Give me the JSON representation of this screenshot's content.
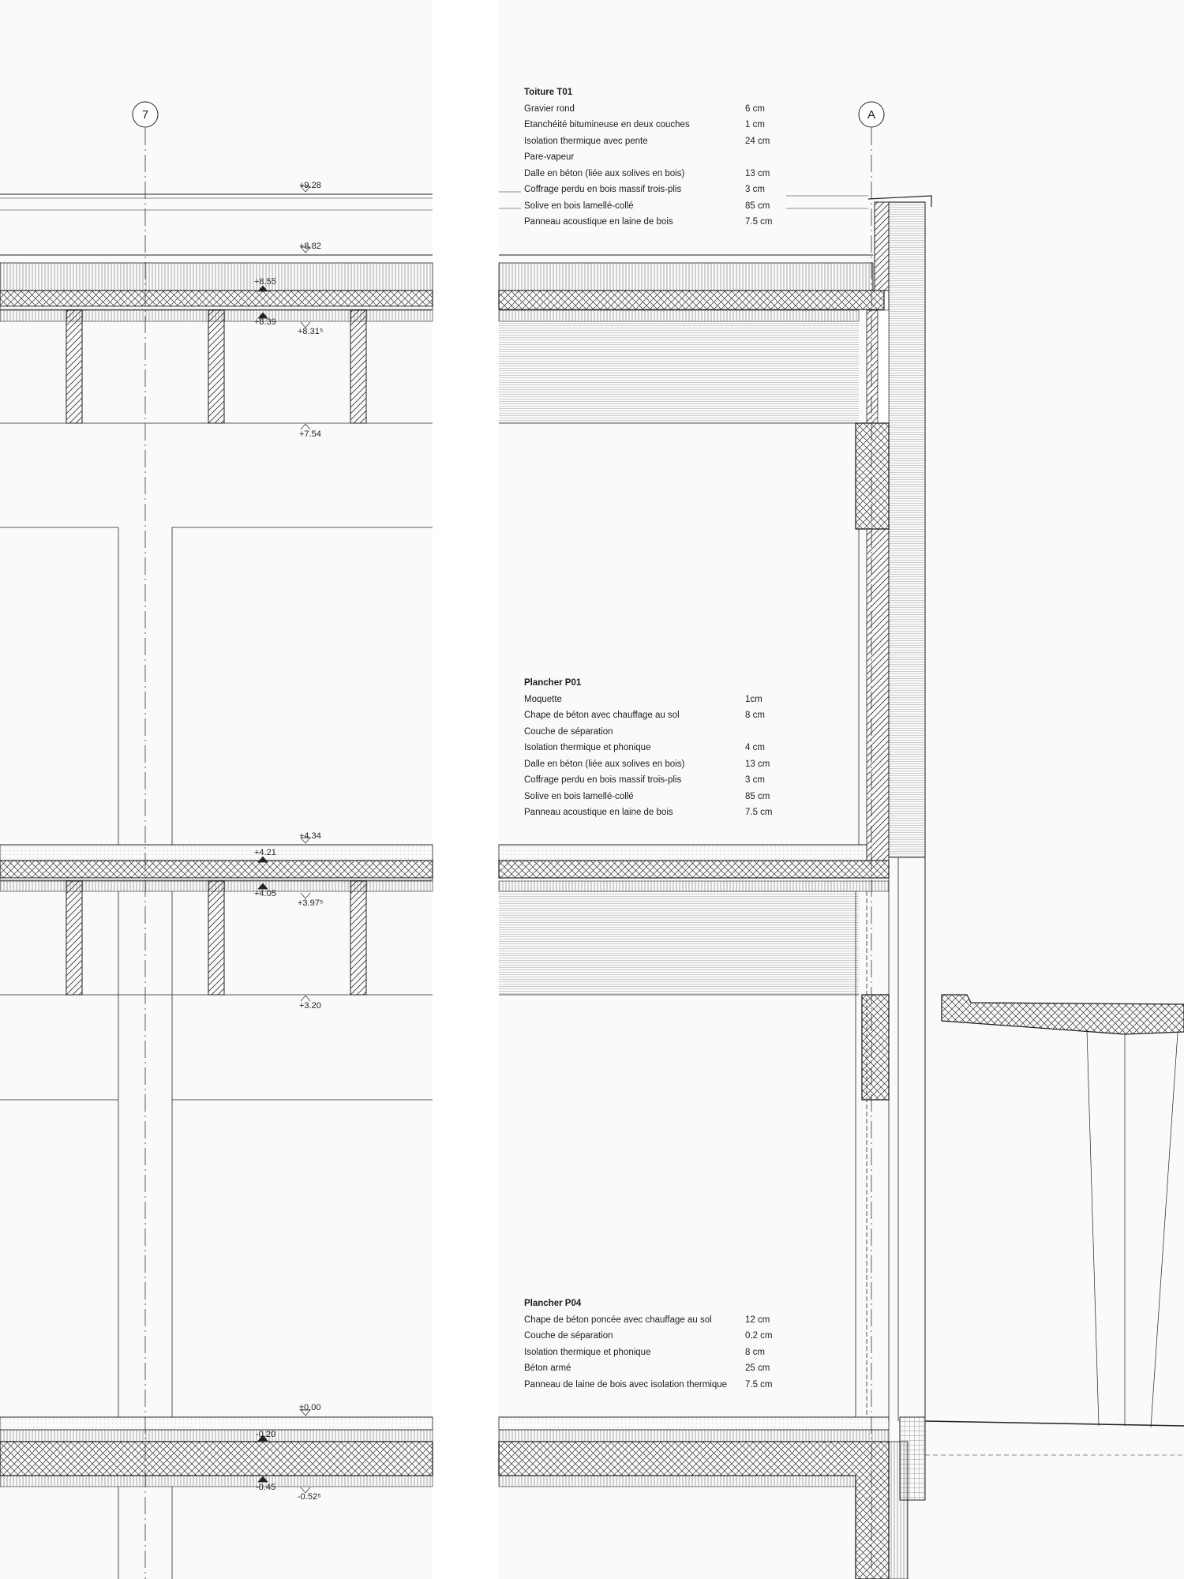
{
  "axes": {
    "left": "7",
    "right": "A"
  },
  "levels": {
    "l928": "+9.28",
    "l882": "+8.82",
    "l855": "+8.55",
    "l839": "+8.39",
    "l831": "+8.31⁵",
    "l754": "+7.54",
    "l434": "+4.34",
    "l421": "+4.21",
    "l405": "+4.05",
    "l397": "+3.97⁵",
    "l320": "+3.20",
    "l000": "±0.00",
    "lm020": "-0.20",
    "lm045": "-0.45",
    "lm052": "-0.52⁵"
  },
  "build_ups": [
    {
      "title": "Toiture T01",
      "layers": [
        {
          "material": "Gravier rond",
          "thickness": "6 cm"
        },
        {
          "material": "Etanchéité bitumineuse en deux couches",
          "thickness": "1 cm"
        },
        {
          "material": "Isolation thermique avec pente",
          "thickness": "24 cm"
        },
        {
          "material": "Pare-vapeur",
          "thickness": ""
        },
        {
          "material": "Dalle en béton (liée aux solives en bois)",
          "thickness": "13 cm"
        },
        {
          "material": "Coffrage perdu en bois massif trois-plis",
          "thickness": "3 cm"
        },
        {
          "material": "Solive en bois lamellé-collé",
          "thickness": "85 cm"
        },
        {
          "material": "Panneau acoustique en laine de bois",
          "thickness": "7.5 cm"
        }
      ]
    },
    {
      "title": "Plancher P01",
      "layers": [
        {
          "material": "Moquette",
          "thickness": "1cm"
        },
        {
          "material": "Chape de béton avec chauffage au sol",
          "thickness": "8 cm"
        },
        {
          "material": "Couche de séparation",
          "thickness": ""
        },
        {
          "material": "Isolation thermique et phonique",
          "thickness": "4 cm"
        },
        {
          "material": "Dalle en béton (liée aux solives en bois)",
          "thickness": "13 cm"
        },
        {
          "material": "Coffrage perdu en bois massif trois-plis",
          "thickness": "3 cm"
        },
        {
          "material": "Solive en bois lamellé-collé",
          "thickness": "85 cm"
        },
        {
          "material": "Panneau acoustique en laine de bois",
          "thickness": "7.5 cm"
        }
      ]
    },
    {
      "title": "Plancher P04",
      "layers": [
        {
          "material": "Chape de béton poncée avec chauffage au sol",
          "thickness": "12 cm"
        },
        {
          "material": "Couche de séparation",
          "thickness": "0.2 cm"
        },
        {
          "material": "Isolation thermique et phonique",
          "thickness": "8 cm"
        },
        {
          "material": "Béton armé",
          "thickness": "25 cm"
        },
        {
          "material": "Panneau de laine de bois avec isolation thermique",
          "thickness": "7.5 cm"
        }
      ]
    }
  ]
}
